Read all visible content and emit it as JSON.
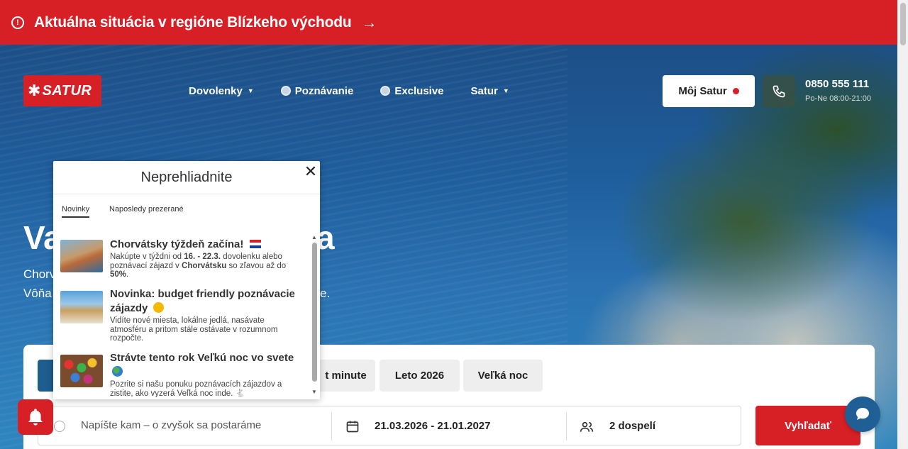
{
  "alert": {
    "text": "Aktuálna situácia v regióne Blízkeho východu",
    "icon": "alert-circle-icon",
    "arrow_icon": "arrow-right-icon"
  },
  "header": {
    "logo_text": "SATUR",
    "nav": [
      {
        "label": "Dovolenky",
        "icon": "caret-down-icon"
      },
      {
        "label": "Poznávanie",
        "icon": "globe-icon"
      },
      {
        "label": "Exclusive",
        "icon": "exclusive-icon"
      },
      {
        "label": "Satur",
        "icon": "caret-down-icon"
      }
    ],
    "account_label": "Môj Satur",
    "phone_number": "0850 555 111",
    "phone_hours": "Po-Ne 08:00-21:00"
  },
  "hero": {
    "title_start": "Va",
    "title_end": "a",
    "sub_line1_start": "Chorv",
    "sub_line2_start": "Vôňa",
    "sub_line2_end": "e."
  },
  "search": {
    "tabs": [
      {
        "label": "t minute"
      },
      {
        "label": "Leto 2026"
      },
      {
        "label": "Veľká noc"
      }
    ],
    "destination_placeholder": "Napíšte kam – o zvyšok sa postaráme",
    "dates": "21.03.2026 - 21.01.2027",
    "travellers": "2 dospelí",
    "submit_label": "Vyhľadať"
  },
  "popup": {
    "title": "Neprehliadnite",
    "tabs": [
      "Novinky",
      "Naposledy prezerané"
    ],
    "items": [
      {
        "title": "Chorvátsky týždeň začína!",
        "desc_parts": [
          "Nakúpte v týždni od ",
          "16. - 22.3.",
          " dovolenku alebo poznávací zájazd v ",
          "Chorvátsku",
          " so zľavou až do ",
          "50%",
          "."
        ]
      },
      {
        "title": "Novinka: budget friendly poznávacie zájazdy",
        "desc": "Vidíte nové miesta, lokálne jedlá, nasávate atmosféru a pritom stále ostávate v rozumnom rozpočte."
      },
      {
        "title": "Strávte tento rok Veľkú noc vo svete",
        "desc": "Pozrite si našu ponuku poznávacích zájazdov a zistite, ako vyzerá Veľká noc inde."
      }
    ]
  },
  "colors": {
    "brand_red": "#d71f26",
    "accent_blue": "#1f5f96"
  }
}
